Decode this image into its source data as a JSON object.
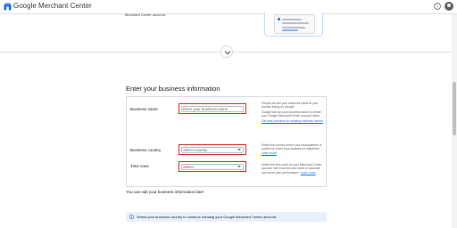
{
  "app": {
    "title": "Google Merchant Center"
  },
  "previous_section": {
    "text": "Merchant Center account."
  },
  "section": {
    "title": "Enter your business information"
  },
  "fields": {
    "business_name": {
      "label": "Business name",
      "placeholder": "Enter your business name",
      "value": ""
    },
    "business_country": {
      "label": "Business country",
      "selected": "Select country"
    },
    "time_zone": {
      "label": "Time zone",
      "selected": "Select"
    }
  },
  "help": {
    "business_name": {
      "p1": "People will see your business name at your product listing on Google.",
      "p2": "Google will use your business name to create your Google Merchant Center account name.",
      "link": "Get best practices for creating business names"
    },
    "business_country": {
      "text": "Select the country where your headquarters is located or where your business is registered.",
      "link": "Learn more"
    },
    "time_zone": {
      "text": "Select the time zone for your Merchant Center account. We'll use this time zone to calculate and report your performance.",
      "link": "Learn more"
    }
  },
  "note": "You can edit your business information later",
  "banner": {
    "text": "Select your business country to continue creating your Google Merchant Center account."
  },
  "icons": {
    "logo": "merchant-center-logo-icon",
    "help": "help-icon",
    "avatar": "account-avatar",
    "expand": "chevron-down-icon",
    "info": "info-icon"
  },
  "colors": {
    "highlight": "#d93025",
    "accent": "#1a73e8",
    "banner_bg": "#e8f0fe"
  }
}
